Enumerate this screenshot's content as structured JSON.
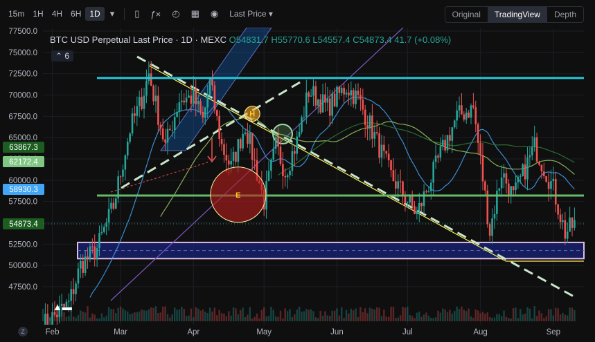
{
  "toolbar": {
    "timeframes": [
      "15m",
      "1H",
      "4H",
      "6H",
      "1D"
    ],
    "active_timeframe": "1D",
    "price_mode": "Last Price",
    "view_modes": [
      "Original",
      "TradingView",
      "Depth"
    ],
    "active_view": "TradingView"
  },
  "legend": {
    "title": "BTC USD Perpetual Last Price · 1D · MEXC",
    "ohlc": "O54831.7 H55770.6 L54557.4 C54873.4 41.7 (+0.08%)",
    "indicator_count": "6"
  },
  "zoom_label": "Z",
  "chart_data": {
    "type": "candlestick",
    "title": "BTC USD Perpetual Last Price · 1D · MEXC",
    "ylim": [
      45000,
      77500
    ],
    "y_ticks": [
      47500,
      50000,
      52500,
      55000,
      57500,
      60000,
      62500,
      65000,
      67500,
      70000,
      72500,
      75000,
      77500
    ],
    "y_tick_labels": [
      "47500.0",
      "50000.0",
      "52500.0",
      "55000.0",
      "57500.0",
      "60000.0",
      "62500.0",
      "65000.0",
      "67500.0",
      "70000.0",
      "72500.0",
      "75000.0",
      "77500.0"
    ],
    "x_tick_labels": [
      "Feb",
      "Mar",
      "Apr",
      "May",
      "Jun",
      "Jul",
      "Aug",
      "Sep"
    ],
    "x_tick_dates": [
      "2024-02-01",
      "2024-03-01",
      "2024-04-01",
      "2024-05-01",
      "2024-06-01",
      "2024-07-01",
      "2024-08-01",
      "2024-09-01"
    ],
    "x_range": [
      "2024-01-28",
      "2024-09-14"
    ],
    "close_anchors": [
      [
        "2024-01-28",
        43000
      ],
      [
        "2024-02-08",
        45500
      ],
      [
        "2024-02-13",
        50000
      ],
      [
        "2024-02-20",
        52000
      ],
      [
        "2024-02-27",
        57000
      ],
      [
        "2024-03-05",
        66000
      ],
      [
        "2024-03-10",
        69500
      ],
      [
        "2024-03-13",
        72500
      ],
      [
        "2024-03-20",
        64000
      ],
      [
        "2024-03-26",
        69500
      ],
      [
        "2024-04-01",
        69700
      ],
      [
        "2024-04-05",
        67000
      ],
      [
        "2024-04-08",
        71500
      ],
      [
        "2024-04-13",
        64000
      ],
      [
        "2024-04-17",
        61500
      ],
      [
        "2024-04-23",
        66500
      ],
      [
        "2024-05-01",
        57500
      ],
      [
        "2024-05-06",
        64000
      ],
      [
        "2024-05-10",
        61000
      ],
      [
        "2024-05-15",
        64500
      ],
      [
        "2024-05-20",
        70500
      ],
      [
        "2024-05-28",
        68500
      ],
      [
        "2024-06-05",
        71000
      ],
      [
        "2024-06-10",
        69500
      ],
      [
        "2024-06-15",
        66500
      ],
      [
        "2024-06-24",
        60500
      ],
      [
        "2024-07-05",
        56000
      ],
      [
        "2024-07-15",
        63000
      ],
      [
        "2024-07-22",
        67500
      ],
      [
        "2024-07-29",
        68500
      ],
      [
        "2024-08-05",
        54000
      ],
      [
        "2024-08-10",
        61000
      ],
      [
        "2024-08-15",
        58000
      ],
      [
        "2024-08-24",
        64000
      ],
      [
        "2024-09-01",
        59000
      ],
      [
        "2024-09-06",
        53800
      ],
      [
        "2024-09-10",
        54873
      ]
    ],
    "price_labels": [
      {
        "value": 63867.3,
        "label": "63867.3",
        "color": "#1b5e20"
      },
      {
        "value": 62172.4,
        "label": "62172.4",
        "color": "#81c784"
      },
      {
        "value": 58930.3,
        "label": "58930.3",
        "color": "#42a5f5"
      },
      {
        "value": 54873.4,
        "label": "54873.4",
        "color": "#1b5e20"
      }
    ],
    "horizontal_levels": [
      {
        "value": 72000,
        "color": "#26c6da"
      },
      {
        "value": 58200,
        "color": "#66bb6a"
      }
    ],
    "support_zone": [
      50800,
      52700
    ],
    "annotations": [
      {
        "label": "E",
        "date": "2024-04-20",
        "value": 58300,
        "color": "#b71c1c"
      },
      {
        "label": "H",
        "date": "2024-04-26",
        "value": 67800,
        "color": "#f9a825"
      }
    ]
  }
}
